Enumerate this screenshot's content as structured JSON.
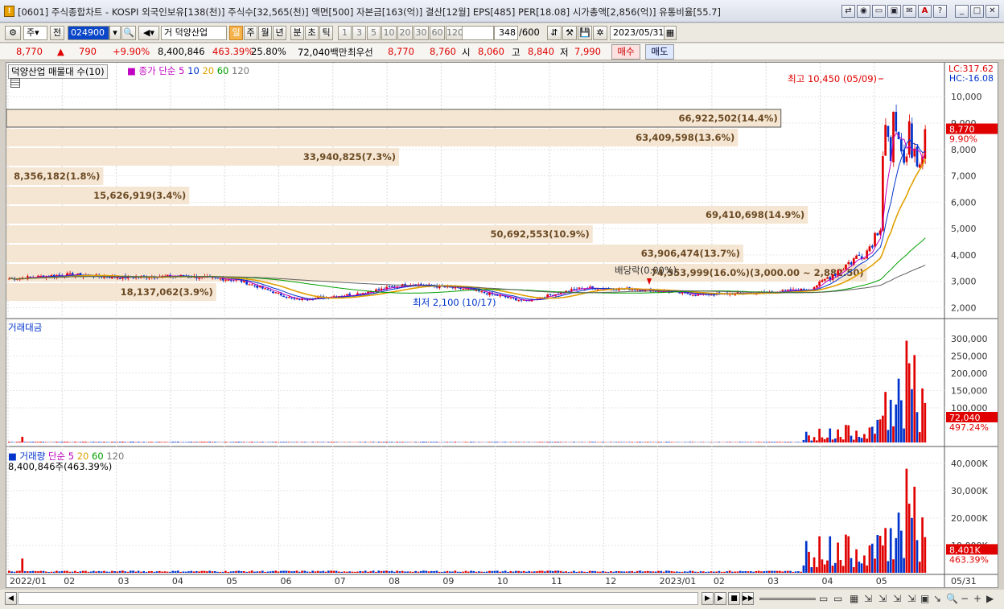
{
  "window": {
    "title": "[0601] 주식종합차트 - KOSPI 외국인보유[138(천)] 주식수[32,565(천)] 액면[500] 자본금[163(억)] 결산[12월] EPS[485] PER[18.08] 시가총액[2,856(억)] 유통비율[55.7]"
  },
  "toolbar": {
    "market_select": "주",
    "prev_label": "전",
    "stock_code": "024900",
    "stock_name": "거 덕양산업",
    "periods": [
      "일",
      "주",
      "월",
      "년",
      "분",
      "초",
      "틱"
    ],
    "intervals": [
      "1",
      "3",
      "5",
      "10",
      "20",
      "30",
      "60",
      "120"
    ],
    "count": "348",
    "count_total": "/600",
    "date": "2023/05/31"
  },
  "quote": {
    "price": "8,770",
    "change": "790",
    "change_pct": "+9.90%",
    "volume": "8,400,846",
    "volume_ratio": "463.39%",
    "turnover": "25.80%",
    "trade_value": "72,040백만",
    "best_label": "최우선",
    "ask": "8,770",
    "bid": "8,760",
    "open_label": "시",
    "open": "8,060",
    "high_label": "고",
    "high": "8,840",
    "low_label": "저",
    "low": "7,990",
    "buy_label": "매수",
    "sell_label": "매도"
  },
  "price_panel": {
    "box_label": "덕양산업 매물대 수(10)",
    "ma_title": "종가 단순 5",
    "ma_periods": [
      "10",
      "20",
      "60",
      "120"
    ],
    "lc": "LC:317.62",
    "hc": "HC:-16.08",
    "high_note": "최고 10,450 (05/09)",
    "low_note": "최저 2,100 (10/17)",
    "dividend_note": "배당락(0.00%)",
    "current_price_tag": "8,770",
    "current_change_tag": "9.90%",
    "y_ticks": [
      "10,000",
      "9,000",
      "8,000",
      "7,000",
      "6,000",
      "5,000",
      "4,000",
      "3,000",
      "2,000"
    ]
  },
  "volume_profile": [
    {
      "label": "66,922,502(14.4%)",
      "pct": 14.4
    },
    {
      "label": "63,409,598(13.6%)",
      "pct": 13.6
    },
    {
      "label": "33,940,825(7.3%)",
      "pct": 7.3
    },
    {
      "label": "8,356,182(1.8%)",
      "pct": 1.8
    },
    {
      "label": "15,626,919(3.4%)",
      "pct": 3.4
    },
    {
      "label": "69,410,698(14.9%)",
      "pct": 14.9
    },
    {
      "label": "50,692,553(10.9%)",
      "pct": 10.9
    },
    {
      "label": "63,906,474(13.7%)",
      "pct": 13.7
    },
    {
      "label": "74,553,999(16.0%)(3,000.00 ~ 2,882.50)",
      "pct": 16.0
    },
    {
      "label": "18,137,062(3.9%)",
      "pct": 3.9
    }
  ],
  "amount_panel": {
    "title": "거래대금",
    "y_ticks": [
      "300,000",
      "250,000",
      "200,000",
      "150,000",
      "100,000"
    ],
    "current_tag": "72,040",
    "ratio_tag": "497.24%"
  },
  "volume_panel": {
    "title": "거래량",
    "ma_title": "단순 5",
    "ma_periods": [
      "20",
      "60",
      "120"
    ],
    "info": "8,400,846주(463.39%)",
    "y_ticks": [
      "40,000K",
      "30,000K",
      "20,000K",
      "10,000K"
    ],
    "current_tag": "8,401K",
    "ratio_tag": "463.39%"
  },
  "x_axis": {
    "labels": [
      "2022/01",
      "02",
      "03",
      "04",
      "05",
      "06",
      "07",
      "08",
      "09",
      "10",
      "11",
      "12",
      "2023/01",
      "02",
      "03",
      "04",
      "05"
    ],
    "end_label": "05/31"
  },
  "chart_data": {
    "type": "line",
    "title": "",
    "x": [
      "2022/01",
      "2022/02",
      "2022/03",
      "2022/04",
      "2022/05",
      "2022/06",
      "2022/07",
      "2022/08",
      "2022/09",
      "2022/10",
      "2022/11",
      "2022/12",
      "2023/01",
      "2023/02",
      "2023/03",
      "2023/04",
      "2023/05"
    ],
    "series": [
      {
        "values": [
          3100,
          3250,
          3150,
          3200,
          3050,
          2300,
          2500,
          2900,
          2700,
          2250,
          2750,
          2700,
          2500,
          2550,
          2700,
          4200,
          8770
        ]
      }
    ],
    "ylim": [
      1800,
      10800
    ],
    "colors": {
      "up": "#e00000",
      "down": "#0033cc",
      "ma5": "#c000c0",
      "ma10": "#0033cc",
      "ma20": "#e0a000",
      "ma60": "#00a000",
      "ma120": "#606060"
    }
  }
}
